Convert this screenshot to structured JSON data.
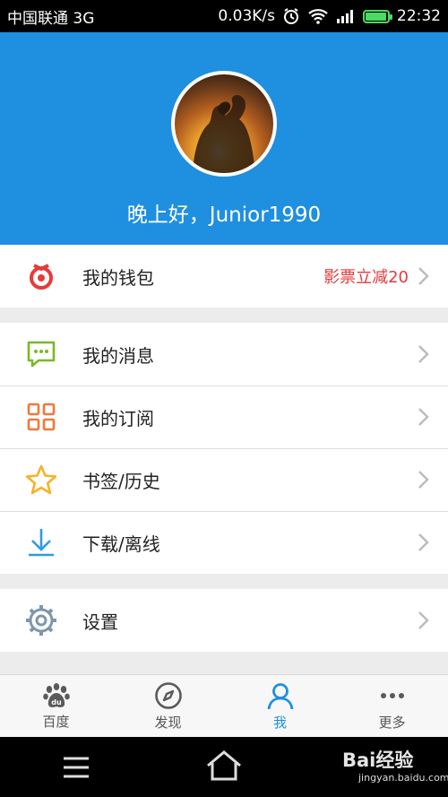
{
  "status_bar": {
    "carrier": "中国联通 3G",
    "speed": "0.03K/s",
    "time": "22:32",
    "battery_level": 0.9
  },
  "header": {
    "greeting": "晚上好，Junior1990"
  },
  "wallet": {
    "label": "我的钱包",
    "promo": "影票立减20"
  },
  "menu": [
    {
      "label": "我的消息",
      "icon": "message-icon"
    },
    {
      "label": "我的订阅",
      "icon": "grid-icon"
    },
    {
      "label": "书签/历史",
      "icon": "star-icon"
    },
    {
      "label": "下载/离线",
      "icon": "download-icon"
    }
  ],
  "settings": {
    "label": "设置",
    "icon": "gear-icon"
  },
  "tabs": [
    {
      "label": "百度",
      "icon": "baidu-paw-icon",
      "active": false
    },
    {
      "label": "发现",
      "icon": "compass-icon",
      "active": false
    },
    {
      "label": "我",
      "icon": "person-icon",
      "active": true
    },
    {
      "label": "更多",
      "icon": "more-dots-icon",
      "active": false
    }
  ],
  "watermark": {
    "brand": "Bai经验",
    "site": "jingyan.baidu.com"
  },
  "colors": {
    "header_blue": "#1f8fe0",
    "promo_red": "#e23a3a",
    "active_tab": "#1f8fe0",
    "wallet_icon": "#e83a3a"
  }
}
